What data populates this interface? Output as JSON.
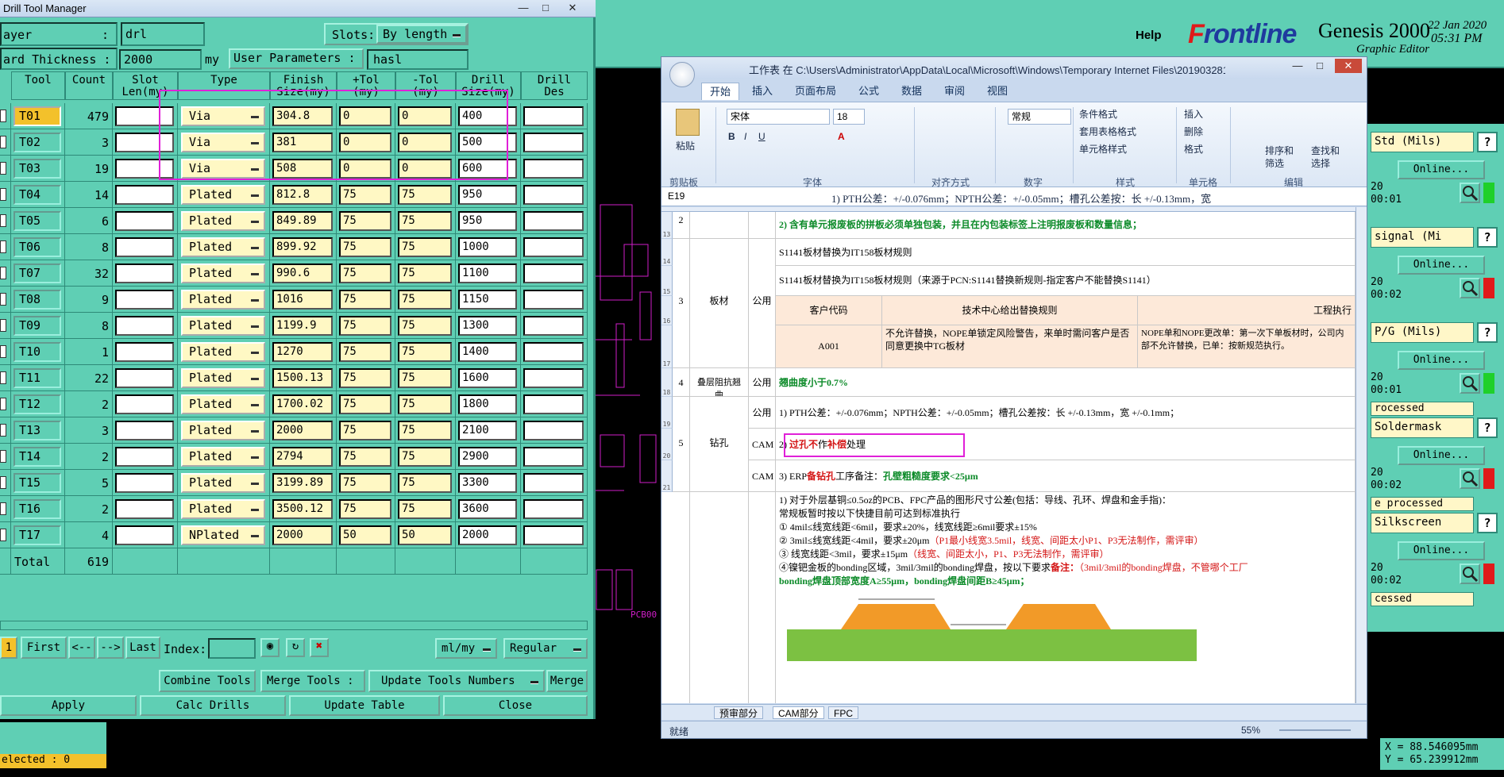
{
  "genesis": {
    "help_label": "Help",
    "logo_prefix": "F",
    "logo_rest": "rontline",
    "product": "Genesis 2000",
    "subtitle": "Graphic Editor",
    "date": "22 Jan 2020",
    "time": "05:31 PM",
    "coords": {
      "x": "X = 88.546095mm",
      "y": "Y = 65.239912mm"
    },
    "layers": [
      {
        "title": "Std (Mils)",
        "online": "Online...",
        "meta1": "20",
        "meta2": "00:01",
        "flag": "green",
        "status": ""
      },
      {
        "title": "signal (Mi",
        "online": "Online...",
        "meta1": "20",
        "meta2": "00:02",
        "flag": "red",
        "status": ""
      },
      {
        "title": "P/G (Mils)",
        "online": "Online...",
        "meta1": "20",
        "meta2": "00:01",
        "flag": "green",
        "status": "rocessed"
      },
      {
        "title": "Soldermask",
        "online": "Online...",
        "meta1": "20",
        "meta2": "00:02",
        "flag": "red",
        "status": "e processed"
      },
      {
        "title": "Silkscreen",
        "online": "Online...",
        "meta1": "20",
        "meta2": "00:02",
        "flag": "red",
        "status": "cessed"
      }
    ],
    "canvas_label": "PCB00"
  },
  "dtm": {
    "title": "Drill Tool Manager",
    "layer_label": "ayer",
    "layer_colon": ":",
    "layer_value": "drl",
    "slots_label": "Slots:",
    "slots_value": "By length",
    "thickness_label": "ard Thickness :",
    "thickness_value": "2000",
    "thickness_unit": "my",
    "user_params_label": "User Parameters :",
    "user_params_value": "hasl",
    "headers": [
      "Tool",
      "Count",
      "Slot\nLen(my)",
      "Type",
      "Finish\nSize(my)",
      "+Tol\n(my)",
      "-Tol\n(my)",
      "Drill\nSize(my)",
      "Drill\nDes"
    ],
    "rows": [
      {
        "tool": "T01",
        "count": "479",
        "type": "Via",
        "finish": "304.8",
        "ptol": "0",
        "mtol": "0",
        "drill": "400"
      },
      {
        "tool": "T02",
        "count": "3",
        "type": "Via",
        "finish": "381",
        "ptol": "0",
        "mtol": "0",
        "drill": "500"
      },
      {
        "tool": "T03",
        "count": "19",
        "type": "Via",
        "finish": "508",
        "ptol": "0",
        "mtol": "0",
        "drill": "600"
      },
      {
        "tool": "T04",
        "count": "14",
        "type": "Plated",
        "finish": "812.8",
        "ptol": "75",
        "mtol": "75",
        "drill": "950"
      },
      {
        "tool": "T05",
        "count": "6",
        "type": "Plated",
        "finish": "849.89",
        "ptol": "75",
        "mtol": "75",
        "drill": "950"
      },
      {
        "tool": "T06",
        "count": "8",
        "type": "Plated",
        "finish": "899.92",
        "ptol": "75",
        "mtol": "75",
        "drill": "1000"
      },
      {
        "tool": "T07",
        "count": "32",
        "type": "Plated",
        "finish": "990.6",
        "ptol": "75",
        "mtol": "75",
        "drill": "1100"
      },
      {
        "tool": "T08",
        "count": "9",
        "type": "Plated",
        "finish": "1016",
        "ptol": "75",
        "mtol": "75",
        "drill": "1150"
      },
      {
        "tool": "T09",
        "count": "8",
        "type": "Plated",
        "finish": "1199.9",
        "ptol": "75",
        "mtol": "75",
        "drill": "1300"
      },
      {
        "tool": "T10",
        "count": "1",
        "type": "Plated",
        "finish": "1270",
        "ptol": "75",
        "mtol": "75",
        "drill": "1400"
      },
      {
        "tool": "T11",
        "count": "22",
        "type": "Plated",
        "finish": "1500.13",
        "ptol": "75",
        "mtol": "75",
        "drill": "1600"
      },
      {
        "tool": "T12",
        "count": "2",
        "type": "Plated",
        "finish": "1700.02",
        "ptol": "75",
        "mtol": "75",
        "drill": "1800"
      },
      {
        "tool": "T13",
        "count": "3",
        "type": "Plated",
        "finish": "2000",
        "ptol": "75",
        "mtol": "75",
        "drill": "2100"
      },
      {
        "tool": "T14",
        "count": "2",
        "type": "Plated",
        "finish": "2794",
        "ptol": "75",
        "mtol": "75",
        "drill": "2900"
      },
      {
        "tool": "T15",
        "count": "5",
        "type": "Plated",
        "finish": "3199.89",
        "ptol": "75",
        "mtol": "75",
        "drill": "3300"
      },
      {
        "tool": "T16",
        "count": "2",
        "type": "Plated",
        "finish": "3500.12",
        "ptol": "75",
        "mtol": "75",
        "drill": "3600"
      },
      {
        "tool": "T17",
        "count": "4",
        "type": "NPlated",
        "finish": "2000",
        "ptol": "50",
        "mtol": "50",
        "drill": "2000"
      }
    ],
    "total_label": "Total",
    "total_value": "619",
    "nav": {
      "one": "1",
      "first": "First",
      "prev": "<--",
      "next": "-->",
      "last": "Last",
      "index_label": "Index:",
      "units": "ml/my",
      "mode": "Regular"
    },
    "actions": {
      "combine": "Combine Tools",
      "merge": "Merge Tools :",
      "update_numbers": "Update Tools Numbers",
      "merge_btn": "Merge"
    },
    "bottom": {
      "apply": "Apply",
      "calc": "Calc Drills",
      "update_table": "Update Table",
      "close": "Close"
    },
    "selected": "elected : 0"
  },
  "excel": {
    "title": "工作表 在 C:\\Users\\Administrator\\AppData\\Local\\Microsoft\\Windows\\Temporary Internet Files\\20190328135118...",
    "tabs": [
      "开始",
      "插入",
      "页面布局",
      "公式",
      "数据",
      "审阅",
      "视图"
    ],
    "font_name": "宋体",
    "font_size": "18",
    "number_format": "常规",
    "groups": [
      "剪贴板",
      "字体",
      "对齐方式",
      "数字",
      "样式",
      "单元格",
      "编辑"
    ],
    "paste": "粘贴",
    "styles": [
      "条件格式",
      "套用表格格式",
      "单元格样式"
    ],
    "cells": [
      "插入",
      "删除",
      "格式"
    ],
    "edit": [
      "排序和",
      "筛选",
      "查找和",
      "选择"
    ],
    "name_box": "E19",
    "formula": "1) PTH公差：+/-0.076mm；NPTH公差：+/-0.05mm；槽孔公差按：长 +/-0.13mm，宽",
    "r2_text": "2) 含有单元报废板的拼板必须单独包装，并且在内包装标签上注明报废板和数量信息；",
    "r3_no": "3",
    "r3_name": "板材",
    "r3_dept": "公用",
    "r3_a": "S1141板材替换为IT158板材规则",
    "r3_b": "S1141板材替换为IT158板材规则（来源于PCN:S1141替换新规则-指定客户不能替换S1141）",
    "r3_h1": "客户代码",
    "r3_h2": "技术中心给出替换规则",
    "r3_h3": "工程执行",
    "r3_c1": "A001",
    "r3_c2": "不允许替换，NOPE单锁定风险警告，来单时需问客户是否同意更换中TG板材",
    "r3_c3": "NOPE单和NOPE更改单：第一次下单板材时，公司内部不允许替换，已单：按新规范执行。",
    "r4_no": "4",
    "r4_name": "叠层阻抗翘曲",
    "r4_dept": "公用",
    "r4_text": "翘曲度小于0.7%",
    "r5_no": "5",
    "r5_name": "钻孔",
    "r5_d1": "公用",
    "r5_d2": "CAM",
    "r5_d3": "CAM",
    "r5_t1": "1) PTH公差：+/-0.076mm；NPTH公差：+/-0.05mm；槽孔公差按：长 +/-0.13mm，宽 +/-0.1mm；",
    "r5_t2a": "2) ",
    "r5_t2b": "过孔不",
    "r5_t2c": "作",
    "r5_t2d": "补偿",
    "r5_t2e": "处理",
    "r5_t3a": "3) ERP",
    "r5_t3b": "备钻孔",
    "r5_t3c": "工序备注：",
    "r5_t3d": "孔壁粗糙度要求<25μm",
    "r6_l1": "1) 对于外层基铜≤0.5oz的PCB、FPC产品的图形尺寸公差(包括：导线、孔环、焊盘和金手指)：",
    "r6_l2": "常规板暂时按以下快捷目前可达到标准执行",
    "r6_l3": "① 4mil≤线宽线距<6mil，要求±20%，线宽线距≥6mil要求±15%",
    "r6_l4a": "② 3mil≤线宽线距<4mil，要求±20μm",
    "r6_l4b": "（P1最小线宽3.5mil，线宽、间距太小P1、P3无法制作，需评审）",
    "r6_l5a": "③ 线宽线距<3mil，要求±15μm",
    "r6_l5b": "（线宽、间距太小，P1、P3无法制作，需评审）",
    "r6_l6a": "④镍钯金板的bonding区域，3mil/3mil的bonding焊盘，按以下要求",
    "r6_l6b": "备注：",
    "r6_l6c": "（3mil/3mil的bonding焊盘，不管哪个工厂",
    "r6_l7": "bonding焊盘顶部宽度A≥55μm，bonding焊盘间距B≥45μm；",
    "row_numbers": [
      "13",
      "14",
      "15",
      "16",
      "17",
      "18",
      "19",
      "20",
      "21"
    ],
    "sheet_tabs": [
      "预审部分",
      "CAM部分",
      "FPC"
    ],
    "status_ready": "就绪",
    "zoom": "55%"
  }
}
